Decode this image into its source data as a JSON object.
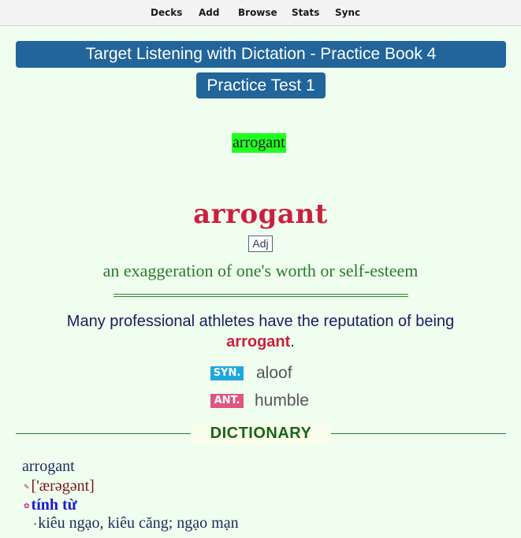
{
  "toolbar": {
    "items": [
      {
        "label": "Decks"
      },
      {
        "label": "Add"
      },
      {
        "label": "Browse"
      },
      {
        "label": "Stats"
      },
      {
        "label": "Sync"
      }
    ]
  },
  "card": {
    "deck_title": "Target Listening with Dictation - Practice Book 4",
    "test_title": "Practice Test 1",
    "audio_word": "arrogant",
    "headword": "arrogant",
    "part_of_speech": "Adj",
    "definition": "an exaggeration of one's worth or self-esteem",
    "example": {
      "before": "Many professional athletes have the reputation of being ",
      "highlight": "arrogant",
      "after": "."
    },
    "synonym": {
      "tag": "SYN.",
      "word": "aloof"
    },
    "antonym": {
      "tag": "ANT.",
      "word": "humble"
    },
    "dictionary": {
      "label": "DICTIONARY",
      "word": "arrogant",
      "pronunciation": "['ærəgənt]",
      "word_type": "tính từ",
      "meaning": "kiêu ngạo, kiêu căng; ngạo mạn"
    }
  },
  "colors": {
    "background": "#effeef",
    "banner": "#21659a",
    "headword": "#cc1f3d",
    "definition": "#2a7a2a",
    "audio_highlight": "#22ff22",
    "syn_tag": "#1fa7de",
    "ant_tag": "#e0557d",
    "dictionary_label": "#176617"
  },
  "icons": {
    "pronunciation_mark": "pen-mark-icon",
    "word_type_mark": "star-mark-icon",
    "meaning_mark": "bullet-mark-icon"
  }
}
